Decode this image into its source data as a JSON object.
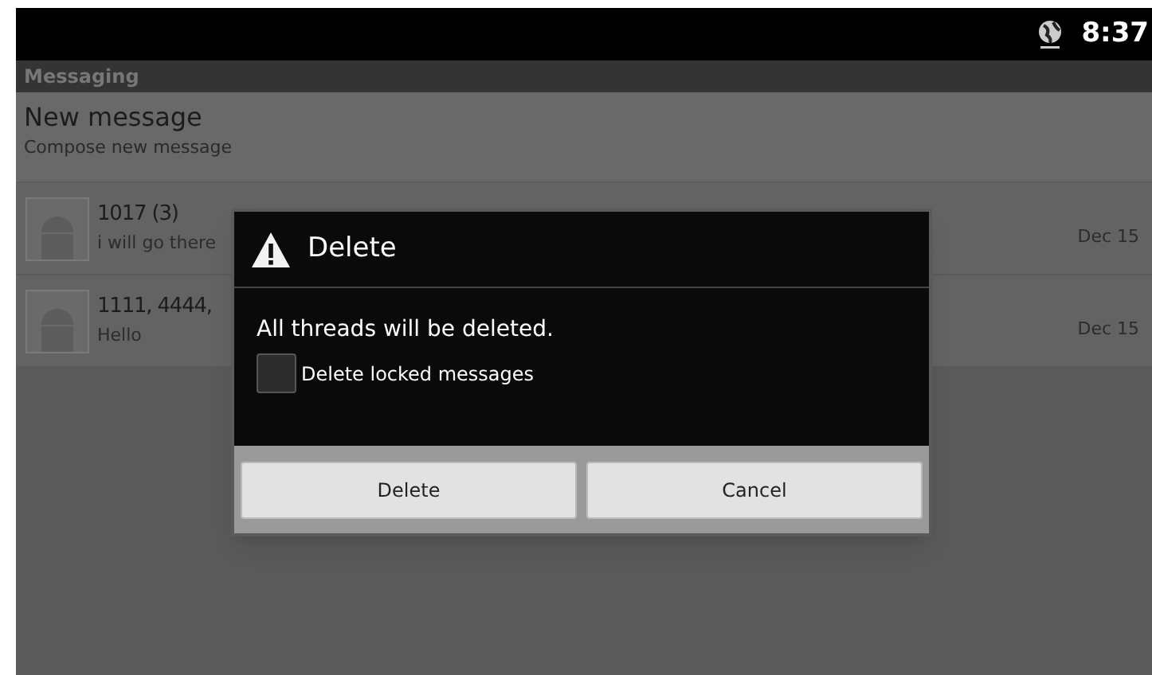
{
  "status_bar": {
    "time": "8:37"
  },
  "title_bar": {
    "title": "Messaging"
  },
  "new_message": {
    "title": "New message",
    "subtitle": "Compose new message"
  },
  "threads": [
    {
      "name": "1017 (3)",
      "snippet": "i will go there",
      "date": "Dec 15"
    },
    {
      "name": "1111, 4444,",
      "snippet": "Hello",
      "date": "Dec 15"
    }
  ],
  "dialog": {
    "title": "Delete",
    "message": "All threads will be deleted.",
    "checkbox": {
      "label": "Delete locked messages",
      "checked": false
    },
    "buttons": [
      "Delete",
      "Cancel"
    ]
  }
}
